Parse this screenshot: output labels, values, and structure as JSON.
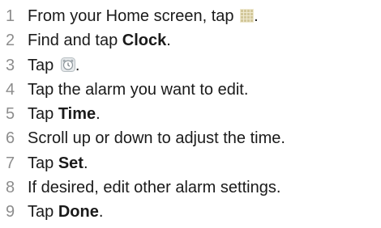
{
  "steps": [
    {
      "num": "1",
      "text_before": "From your Home screen, tap ",
      "icon": "apps-grid-icon",
      "text_after": "."
    },
    {
      "num": "2",
      "text_before": "Find and tap ",
      "bold": "Clock",
      "text_after": "."
    },
    {
      "num": "3",
      "text_before": "Tap ",
      "icon": "alarm-clock-icon",
      "text_after": "."
    },
    {
      "num": "4",
      "text": "Tap the alarm you want to edit."
    },
    {
      "num": "5",
      "text_before": "Tap ",
      "bold": "Time",
      "text_after": "."
    },
    {
      "num": "6",
      "text": "Scroll up or down to adjust the time."
    },
    {
      "num": "7",
      "text_before": "Tap ",
      "bold": "Set",
      "text_after": "."
    },
    {
      "num": "8",
      "text": "If desired, edit other alarm settings."
    },
    {
      "num": "9",
      "text_before": "Tap ",
      "bold": "Done",
      "text_after": "."
    }
  ],
  "colors": {
    "text": "#1a1a1a",
    "number": "#8d8d8d",
    "icon_grid": "#d9d0a8",
    "icon_alarm": "#9aa3a8"
  }
}
